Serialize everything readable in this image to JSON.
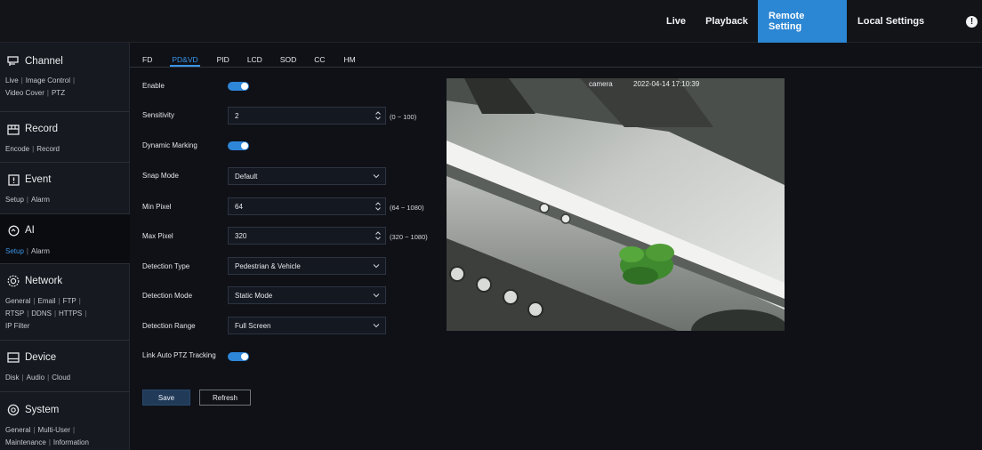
{
  "topnav": {
    "live": "Live",
    "playback": "Playback",
    "remote_setting": "Remote Setting",
    "local_settings": "Local Settings",
    "help_glyph": "!"
  },
  "sidebar": {
    "sections": [
      {
        "title": "Channel",
        "icon": "channel-icon",
        "links": [
          "Live",
          "Image Control",
          "Video Cover",
          "PTZ"
        ]
      },
      {
        "title": "Record",
        "icon": "record-icon",
        "links": [
          "Encode",
          "Record"
        ]
      },
      {
        "title": "Event",
        "icon": "event-icon",
        "links": [
          "Setup",
          "Alarm"
        ]
      },
      {
        "title": "AI",
        "icon": "ai-icon",
        "links": [
          "Setup",
          "Alarm"
        ],
        "active_link": "Setup"
      },
      {
        "title": "Network",
        "icon": "network-icon",
        "links": [
          "General",
          "Email",
          "FTP",
          "RTSP",
          "DDNS",
          "HTTPS",
          "IP Filter"
        ]
      },
      {
        "title": "Device",
        "icon": "device-icon",
        "links": [
          "Disk",
          "Audio",
          "Cloud"
        ]
      },
      {
        "title": "System",
        "icon": "system-icon",
        "links": [
          "General",
          "Multi-User",
          "Maintenance",
          "Information"
        ]
      }
    ]
  },
  "tabs": [
    "FD",
    "PD&VD",
    "PID",
    "LCD",
    "SOD",
    "CC",
    "HM"
  ],
  "active_tab": "PD&VD",
  "form": {
    "enable_label": "Enable",
    "enable_value": true,
    "sensitivity_label": "Sensitivity",
    "sensitivity_value": "2",
    "sensitivity_range": "(0 ~ 100)",
    "dynamic_marking_label": "Dynamic Marking",
    "dynamic_marking_value": true,
    "snap_mode_label": "Snap Mode",
    "snap_mode_value": "Default",
    "min_pixel_label": "Min Pixel",
    "min_pixel_value": "64",
    "min_pixel_range": "(64 ~ 1080)",
    "max_pixel_label": "Max Pixel",
    "max_pixel_value": "320",
    "max_pixel_range": "(320 ~ 1080)",
    "detection_type_label": "Detection Type",
    "detection_type_value": "Pedestrian & Vehicle",
    "detection_mode_label": "Detection Mode",
    "detection_mode_value": "Static Mode",
    "detection_range_label": "Detection Range",
    "detection_range_value": "Full Screen",
    "link_ptz_label": "Link Auto PTZ Tracking",
    "link_ptz_value": true
  },
  "buttons": {
    "save": "Save",
    "refresh": "Refresh"
  },
  "preview": {
    "osd_name": "camera",
    "osd_time": "2022-04-14 17:10:39"
  },
  "colors": {
    "accent": "#2b86d4",
    "active_link": "#3b95e6",
    "toggle_on": "#2e86d8"
  }
}
